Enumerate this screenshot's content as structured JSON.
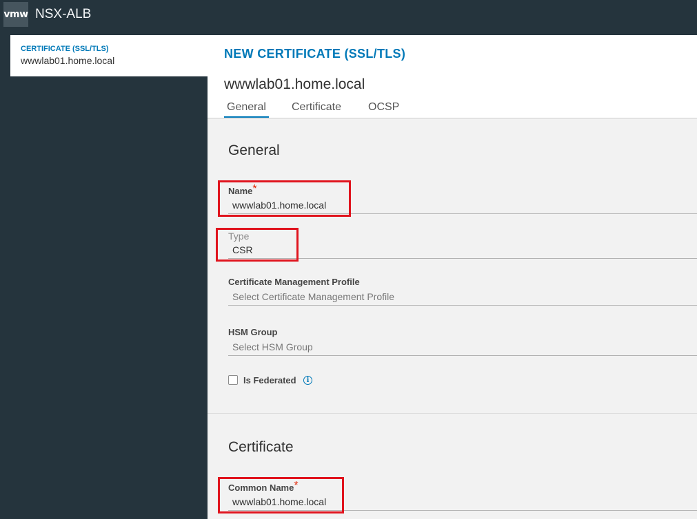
{
  "app": {
    "logo": "vmw",
    "title": "NSX-ALB"
  },
  "sidebar": {
    "kicker": "CERTIFICATE (SSL/TLS)",
    "item_name": "wwwlab01.home.local"
  },
  "modal": {
    "title": "NEW CERTIFICATE (SSL/TLS)",
    "cert_name": "wwwlab01.home.local",
    "tabs": [
      {
        "label": "General",
        "active": true
      },
      {
        "label": "Certificate",
        "active": false
      },
      {
        "label": "OCSP",
        "active": false
      }
    ]
  },
  "general": {
    "heading": "General",
    "name": {
      "label": "Name",
      "required": "*",
      "value": "wwwlab01.home.local"
    },
    "type": {
      "label": "Type",
      "value": "CSR"
    },
    "cert_mgmt_profile": {
      "label": "Certificate Management Profile",
      "placeholder": "Select Certificate Management Profile"
    },
    "hsm_group": {
      "label": "HSM Group",
      "placeholder": "Select HSM Group"
    },
    "is_federated": {
      "label": "Is Federated",
      "checked": false,
      "info_icon": "info-icon"
    }
  },
  "certificate": {
    "heading": "Certificate",
    "common_name": {
      "label": "Common Name",
      "required": "*",
      "value": "wwwlab01.home.local"
    }
  },
  "colors": {
    "accent": "#0079b8",
    "highlight": "#e0141e",
    "required": "#e12200",
    "chrome": "#25343d"
  }
}
